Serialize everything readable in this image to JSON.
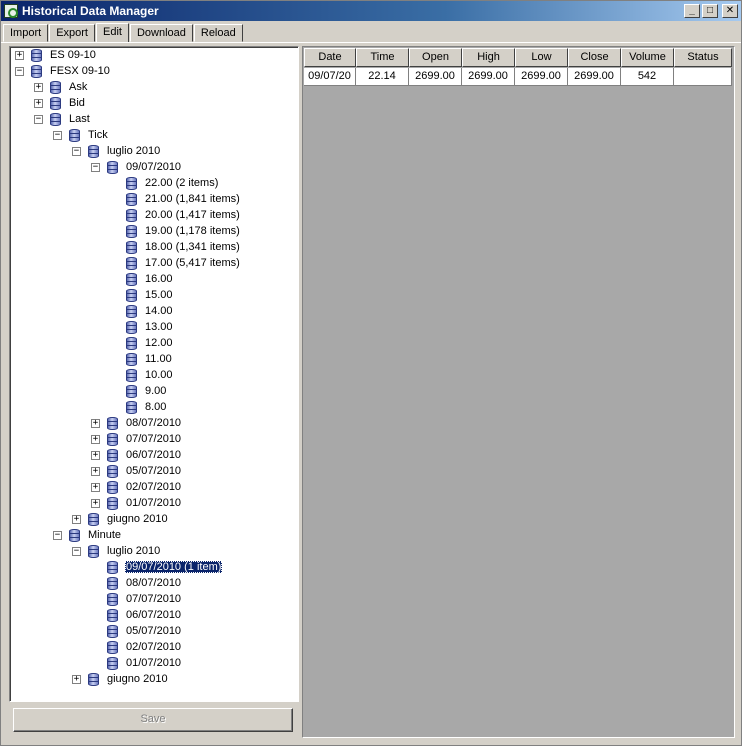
{
  "window": {
    "title": "Historical Data Manager"
  },
  "tabs": [
    {
      "label": "Import"
    },
    {
      "label": "Export"
    },
    {
      "label": "Edit"
    },
    {
      "label": "Download"
    },
    {
      "label": "Reload"
    }
  ],
  "tree": {
    "es": "ES 09-10",
    "fesx": "FESX 09-10",
    "ask": "Ask",
    "bid": "Bid",
    "last": "Last",
    "tick": "Tick",
    "luglio_tick": "luglio 2010",
    "d0907": "09/07/2010",
    "h22": "22.00 (2 items)",
    "h21": "21.00 (1,841 items)",
    "h20": "20.00 (1,417 items)",
    "h19": "19.00 (1,178 items)",
    "h18": "18.00 (1,341 items)",
    "h17": "17.00 (5,417 items)",
    "h16": "16.00",
    "h15": "15.00",
    "h14": "14.00",
    "h13": "13.00",
    "h12": "12.00",
    "h11": "11.00",
    "h10": "10.00",
    "h9": "9.00",
    "h8": "8.00",
    "t0807": "08/07/2010",
    "t0707": "07/07/2010",
    "t0607": "06/07/2010",
    "t0507": "05/07/2010",
    "t0207": "02/07/2010",
    "t0107": "01/07/2010",
    "giugno_tick": "giugno 2010",
    "minute": "Minute",
    "luglio_min": "luglio 2010",
    "m0907": "09/07/2010 (1 item)",
    "m0807": "08/07/2010",
    "m0707": "07/07/2010",
    "m0607": "06/07/2010",
    "m0507": "05/07/2010",
    "m0207": "02/07/2010",
    "m0107": "01/07/2010",
    "giugno_min": "giugno 2010"
  },
  "save_label": "Save",
  "grid": {
    "columns": [
      "Date",
      "Time",
      "Open",
      "High",
      "Low",
      "Close",
      "Volume",
      "Status"
    ],
    "row": {
      "date": "09/07/20",
      "time": "22.14",
      "open": "2699.00",
      "high": "2699.00",
      "low": "2699.00",
      "close": "2699.00",
      "volume": "542",
      "status": ""
    }
  }
}
